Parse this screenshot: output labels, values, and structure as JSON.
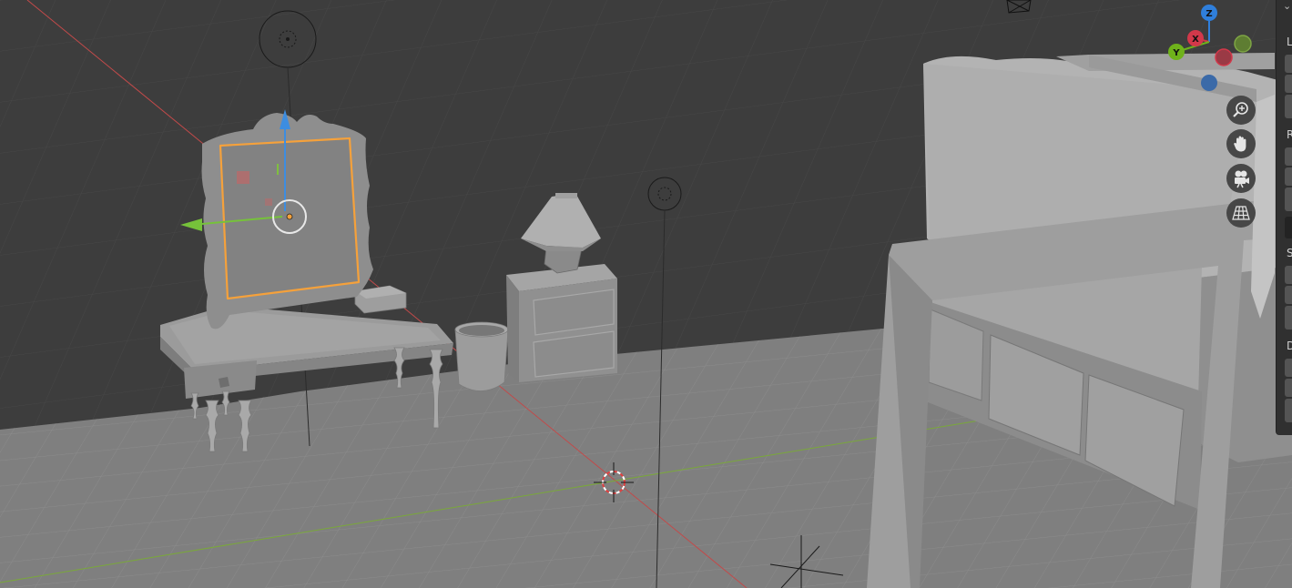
{
  "app": "Blender",
  "viewport": {
    "mode": "3d-viewport-perspective",
    "background": "#3d3d3d",
    "floor_color": "#808080",
    "grid_color": "#4a4a4a",
    "x_axis_color": "#d94c4c",
    "y_axis_color": "#7ab32e",
    "selection_outline_color": "#f5a13b"
  },
  "navigation_gizmo": {
    "axes": [
      {
        "name": "Z",
        "label": "Z",
        "color": "#2f7fdc"
      },
      {
        "name": "X",
        "label": "X",
        "color": "#d2384a"
      },
      {
        "name": "Y",
        "label": "Y",
        "color": "#6fb21b"
      },
      {
        "name": "-X",
        "label": "",
        "color": "#9a3a45"
      },
      {
        "name": "-Y",
        "label": "",
        "color": "#5e7d32"
      },
      {
        "name": "-Z",
        "label": "",
        "color": "#3b6aa8"
      }
    ]
  },
  "nav_buttons": [
    {
      "name": "zoom-button",
      "icon": "zoom-icon"
    },
    {
      "name": "pan-button",
      "icon": "hand-icon"
    },
    {
      "name": "camera-view-button",
      "icon": "camera-icon"
    },
    {
      "name": "ortho-toggle-button",
      "icon": "grid-icon"
    }
  ],
  "side_panel": {
    "collapse_glyph": "⌄",
    "section_labels": [
      "L",
      "R",
      "S",
      "D"
    ]
  },
  "objects": [
    {
      "name": "vanity-mirror",
      "selected": true
    },
    {
      "name": "vanity-table",
      "selected": false
    },
    {
      "name": "waste-bin",
      "selected": false
    },
    {
      "name": "nightstand",
      "selected": false
    },
    {
      "name": "table-lamp",
      "selected": false
    },
    {
      "name": "bed",
      "selected": false
    },
    {
      "name": "point-light-1",
      "selected": false
    },
    {
      "name": "point-light-2",
      "selected": false
    },
    {
      "name": "3d-cursor",
      "selected": false
    }
  ]
}
